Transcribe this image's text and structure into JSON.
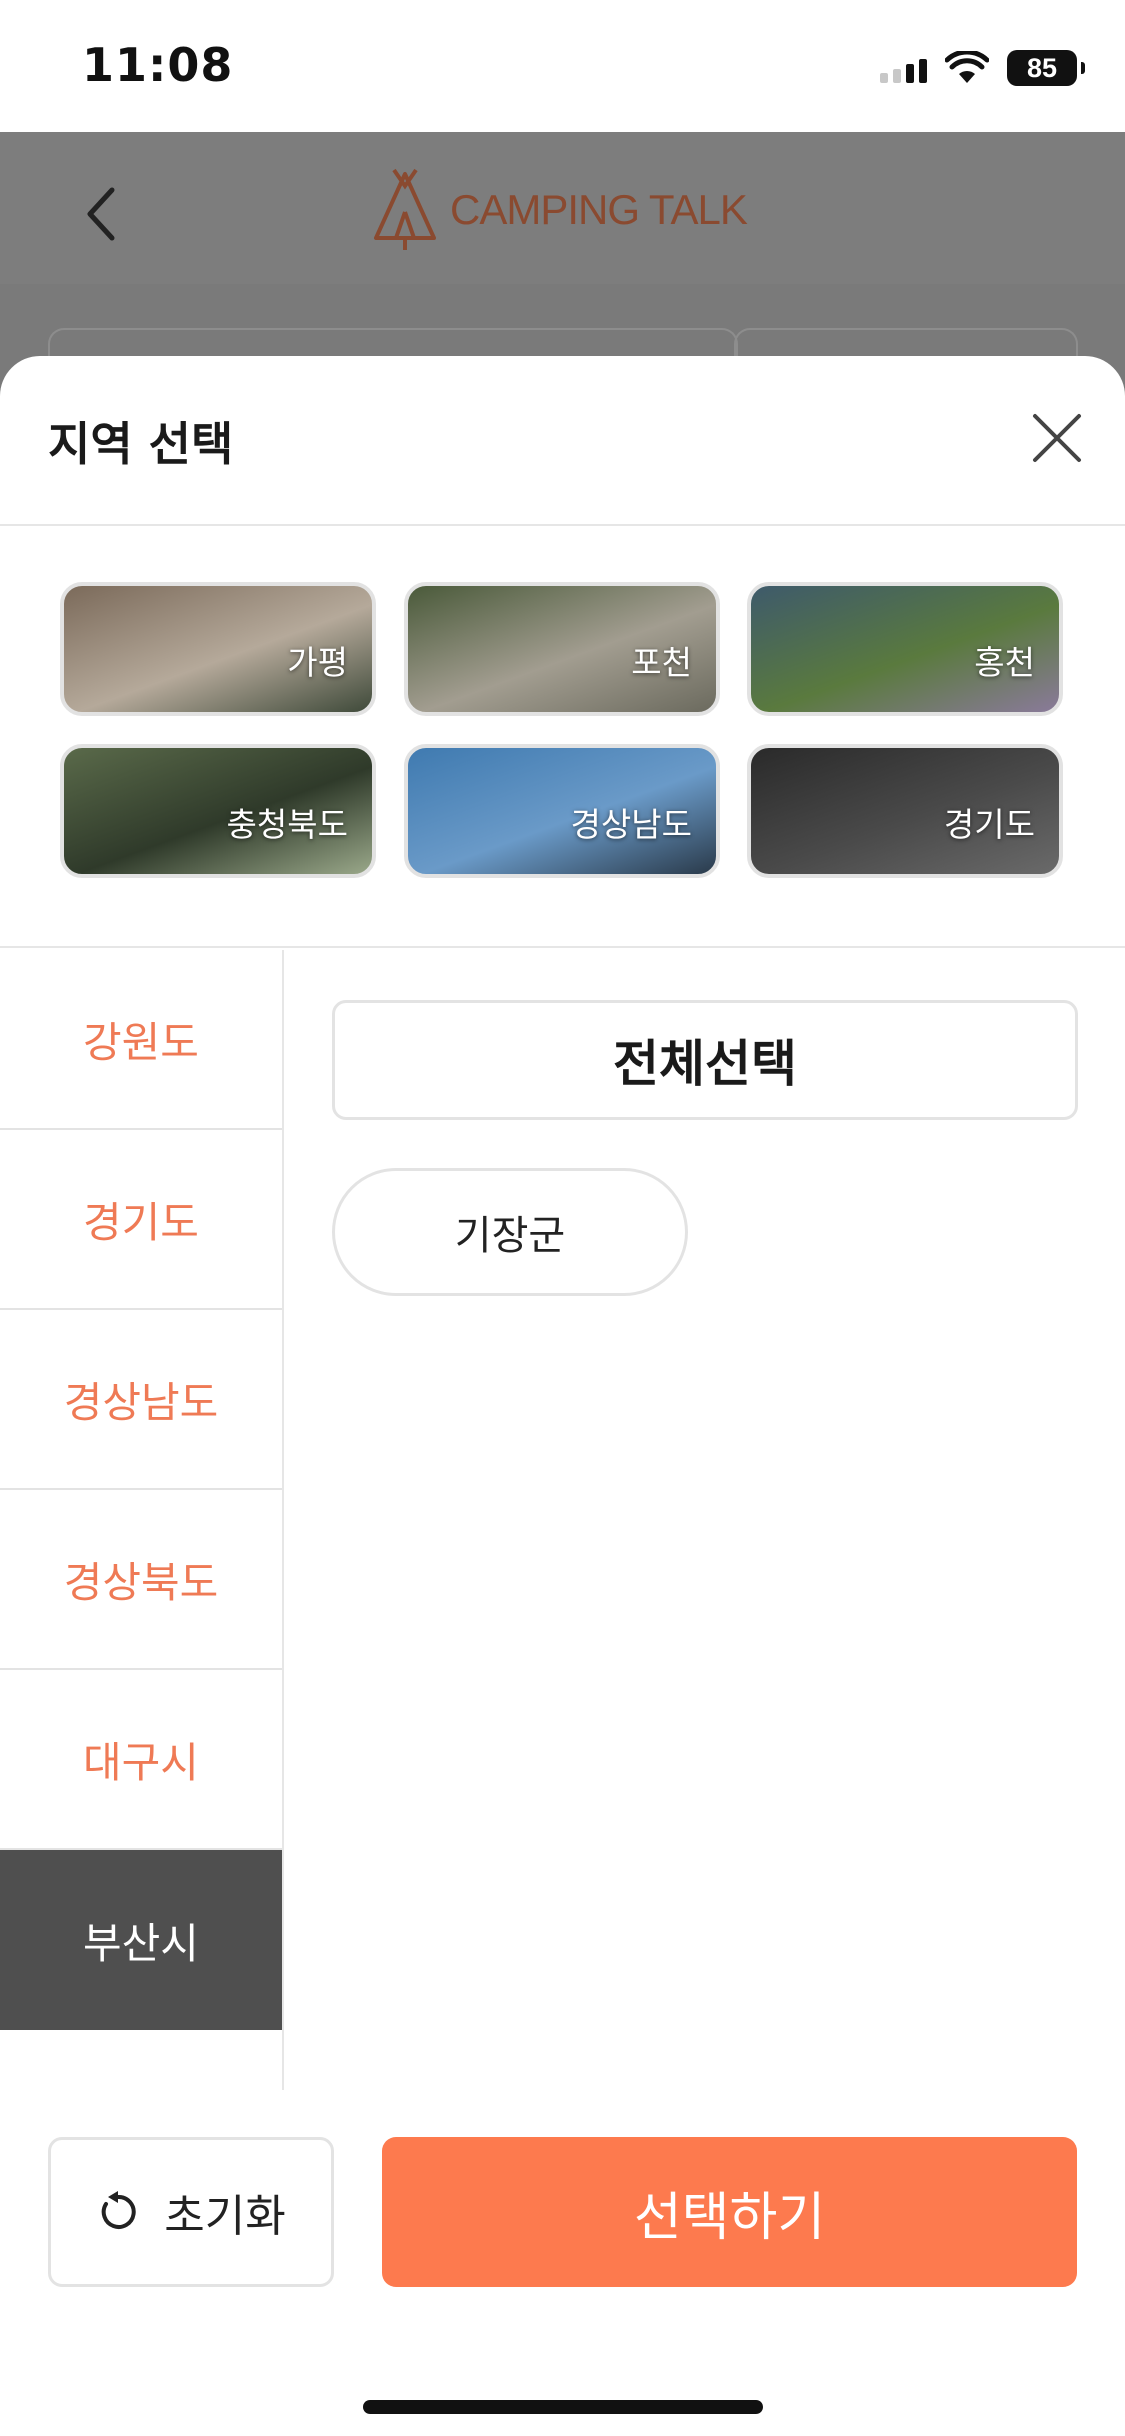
{
  "status_bar": {
    "time": "11:08",
    "battery": "85"
  },
  "app_header": {
    "logo_text": "CAMPING TALK"
  },
  "sheet": {
    "title": "지역 선택",
    "featured": [
      {
        "label": "가평",
        "colors": [
          "#7b6a5a",
          "#b5a99a",
          "#3f4a3a"
        ]
      },
      {
        "label": "포천",
        "colors": [
          "#4a5a3a",
          "#a29d90",
          "#6b6a5e"
        ]
      },
      {
        "label": "홍천",
        "colors": [
          "#3e5a6b",
          "#5a7a3e",
          "#8a7a9a"
        ]
      },
      {
        "label": "충청북도",
        "colors": [
          "#5a6a4a",
          "#2f3a2a",
          "#9aa88a"
        ]
      },
      {
        "label": "경상남도",
        "colors": [
          "#3f7ab0",
          "#6a9ac8",
          "#2a3a4a"
        ]
      },
      {
        "label": "경기도",
        "colors": [
          "#2a2a2a",
          "#4a4a4a",
          "#6a6a6a"
        ]
      }
    ],
    "regions": [
      {
        "label": "강원도",
        "active": false
      },
      {
        "label": "경기도",
        "active": false
      },
      {
        "label": "경상남도",
        "active": false
      },
      {
        "label": "경상북도",
        "active": false
      },
      {
        "label": "대구시",
        "active": false
      },
      {
        "label": "부산시",
        "active": true
      }
    ],
    "select_all_label": "전체선택",
    "districts": [
      {
        "label": "기장군"
      }
    ],
    "reset_label": "초기화",
    "submit_label": "선택하기"
  },
  "colors": {
    "accent": "#fd7a4e",
    "region_text": "#ef7a55",
    "active_region_bg": "#4f4f4f"
  }
}
